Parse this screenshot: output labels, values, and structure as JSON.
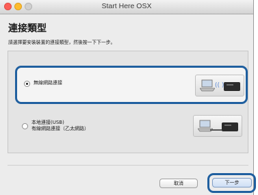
{
  "window": {
    "title": "Start Here OSX"
  },
  "page": {
    "heading": "連接類型",
    "instruction": "請選擇要安裝裝置的連接類型，然後按一下下一步。"
  },
  "options": [
    {
      "lines": [
        "無線網路連接"
      ],
      "selected": true,
      "icon": "laptop-wireless-printer-icon"
    },
    {
      "lines": [
        "本地連接(USB)",
        "有線網路連接（乙太網路）"
      ],
      "selected": false,
      "icon": "laptop-cable-printer-icon"
    }
  ],
  "buttons": {
    "cancel": "取消",
    "next": "下一步"
  },
  "colors": {
    "highlight": "#1f5f9f",
    "traffic_close": "#fc5f57",
    "traffic_min": "#fdbc2e"
  }
}
